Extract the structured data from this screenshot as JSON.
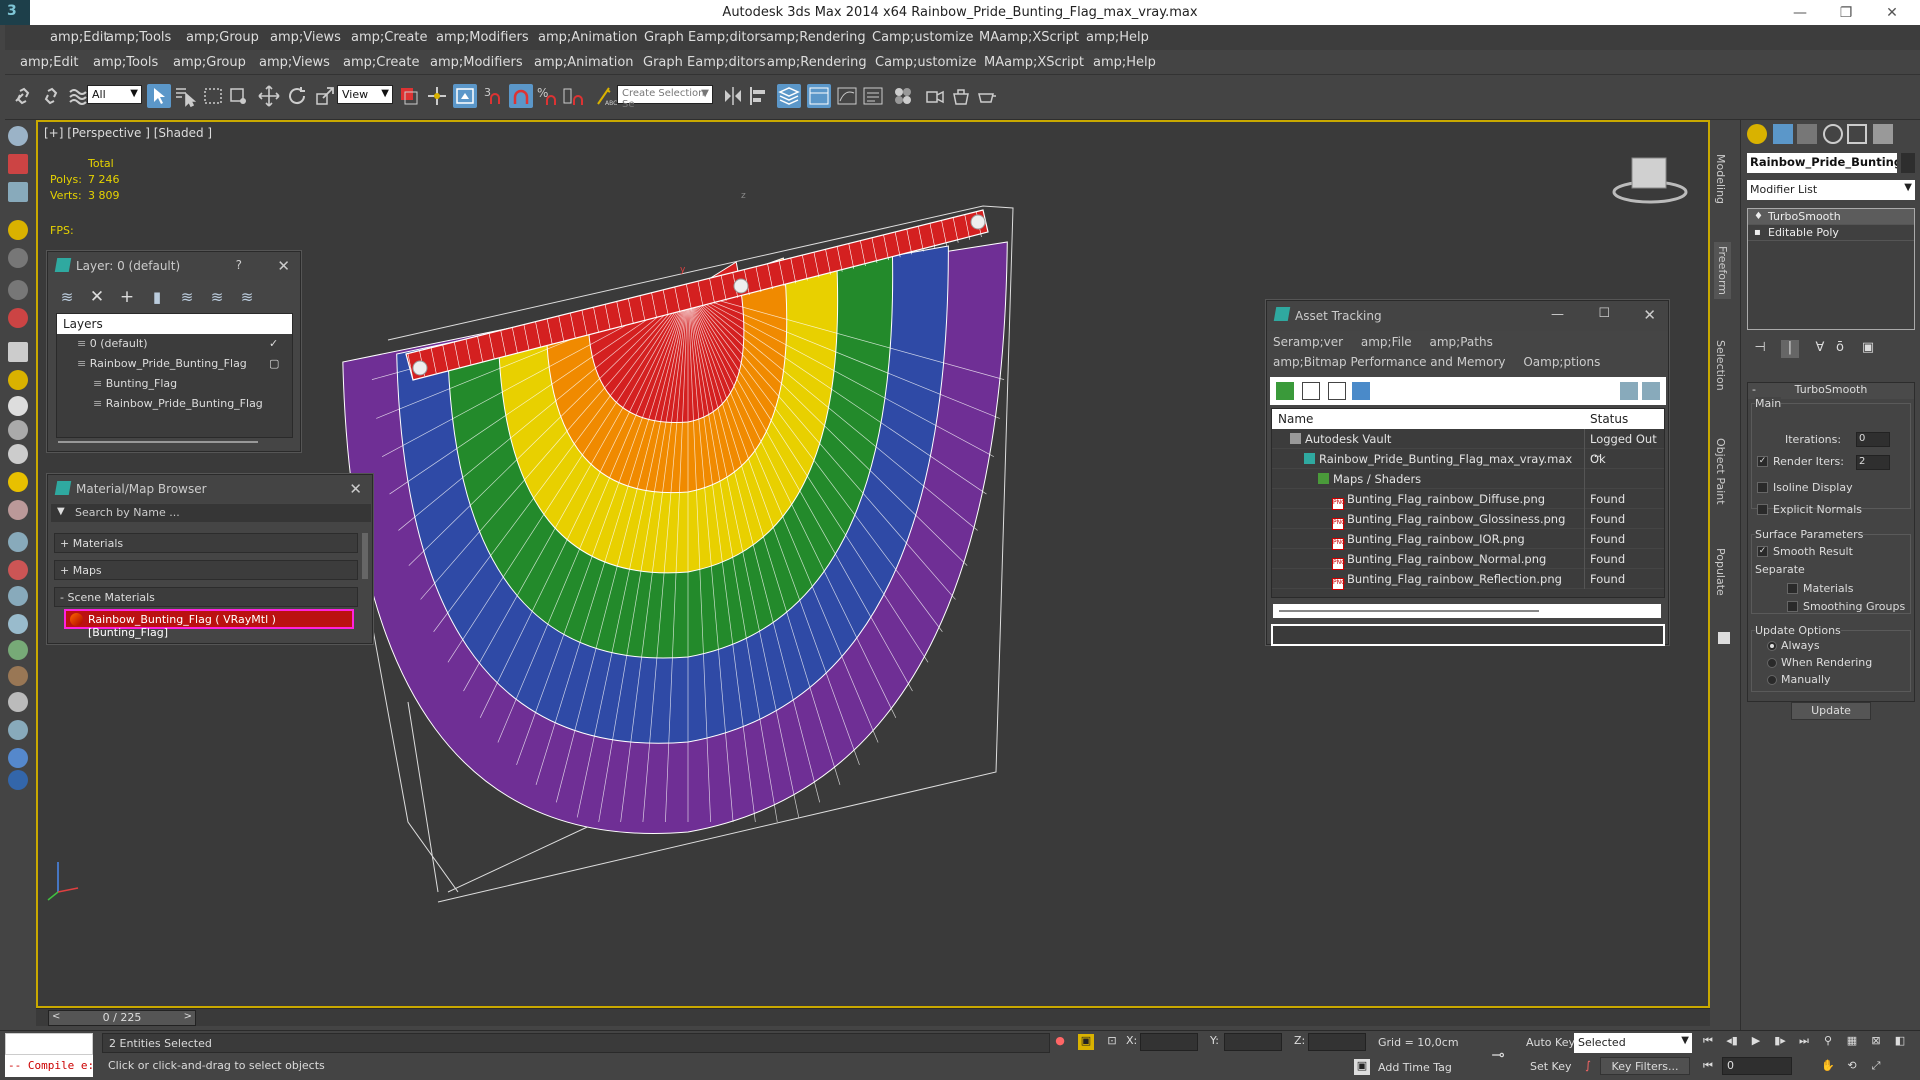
{
  "window": {
    "title": "Autodesk 3ds Max  2014 x64     Rainbow_Pride_Bunting_Flag_max_vray.max",
    "minimize": "—",
    "maximize": "❐",
    "close": "✕"
  },
  "menubar_main": [
    "amp;Edit",
    "amp;Tools",
    "amp;Group",
    "amp;Views",
    "amp;Create",
    "amp;Modifiers",
    "amp;Animation",
    "Graph Eamp;ditors",
    "amp;Rendering",
    "Camp;ustomize",
    "MAamp;XScript",
    "amp;Help"
  ],
  "menubar_secondary": [
    "amp;Edit",
    "amp;Tools",
    "amp;Group",
    "amp;Views",
    "amp;Create",
    "amp;Modifiers",
    "amp;Animation",
    "Graph Eamp;ditors",
    "amp;Rendering",
    "Camp;ustomize",
    "MAamp;XScript",
    "amp;Help"
  ],
  "toolbar": {
    "selection_filter": "All",
    "reference_coord": "View",
    "snap_label": "3",
    "selection_set_placeholder": "Create Selection Se"
  },
  "viewport": {
    "label": "[+] [Perspective ] [Shaded ]",
    "stats": {
      "total_label": "Total",
      "polys_label": "Polys:",
      "polys_value": "7 246",
      "verts_label": "Verts:",
      "verts_value": "3 809",
      "fps_label": "FPS:"
    },
    "axis_z": "z",
    "axis_y": "y"
  },
  "layer_panel": {
    "title": "Layer: 0 (default)",
    "help": "?",
    "close": "✕",
    "header": "Layers",
    "rows": [
      {
        "name": "0 (default)",
        "indent": 0,
        "mark": "✓"
      },
      {
        "name": "Rainbow_Pride_Bunting_Flag",
        "indent": 0,
        "mark": "▢"
      },
      {
        "name": "Bunting_Flag",
        "indent": 1,
        "mark": ""
      },
      {
        "name": "Rainbow_Pride_Bunting_Flag",
        "indent": 1,
        "mark": ""
      }
    ]
  },
  "material_browser": {
    "title": "Material/Map Browser",
    "close": "✕",
    "search_placeholder": "Search by Name ...",
    "groups": [
      "+ Materials",
      "+ Maps",
      "- Scene Materials"
    ],
    "scene_material": "Rainbow_Bunting_Flag  ( VRayMtl )  [Bunting_Flag]"
  },
  "asset_tracking": {
    "title": "Asset Tracking",
    "menu_row1": [
      "Seramp;ver",
      "amp;File",
      "amp;Paths"
    ],
    "menu_row2": [
      "amp;Bitmap Performance and Memory",
      "Oamp;ptions"
    ],
    "columns": [
      "Name",
      "Status"
    ],
    "rows": [
      {
        "name": "Autodesk Vault",
        "status": "Logged Out ...",
        "indent": 1,
        "icon": "vault"
      },
      {
        "name": "Rainbow_Pride_Bunting_Flag_max_vray.max",
        "status": "Ok",
        "indent": 2,
        "icon": "max"
      },
      {
        "name": "Maps / Shaders",
        "status": "",
        "indent": 3,
        "icon": "maps"
      },
      {
        "name": "Bunting_Flag_rainbow_Diffuse.png",
        "status": "Found",
        "indent": 4,
        "icon": "png"
      },
      {
        "name": "Bunting_Flag_rainbow_Glossiness.png",
        "status": "Found",
        "indent": 4,
        "icon": "png"
      },
      {
        "name": "Bunting_Flag_rainbow_IOR.png",
        "status": "Found",
        "indent": 4,
        "icon": "png"
      },
      {
        "name": "Bunting_Flag_rainbow_Normal.png",
        "status": "Found",
        "indent": 4,
        "icon": "png"
      },
      {
        "name": "Bunting_Flag_rainbow_Reflection.png",
        "status": "Found",
        "indent": 4,
        "icon": "png"
      }
    ],
    "png_badge": "PNG"
  },
  "side_tabs": [
    "Modeling",
    "Freeform",
    "Selection",
    "Object Paint",
    "Populate"
  ],
  "command_panel": {
    "object_name": "Rainbow_Pride_Bunting_",
    "modifier_list": "Modifier List",
    "stack": [
      "TurboSmooth",
      "Editable Poly"
    ],
    "rollout_title": "TurboSmooth",
    "main_label": "Main",
    "iterations_label": "Iterations:",
    "iterations_value": "0",
    "render_iters_label": "Render Iters:",
    "render_iters_value": "2",
    "isoline_label": "Isoline Display",
    "explicit_normals_label": "Explicit Normals",
    "surface_params_label": "Surface Parameters",
    "smooth_result_label": "Smooth Result",
    "separate_label": "Separate",
    "materials_label": "Materials",
    "smoothing_groups_label": "Smoothing Groups",
    "update_options_label": "Update Options",
    "always_label": "Always",
    "when_rendering_label": "When Rendering",
    "manually_label": "Manually",
    "update_button": "Update"
  },
  "time_slider": {
    "value": "0 / 225",
    "prev": "<",
    "next": ">"
  },
  "status_bar": {
    "maxscript": "-- Compile e:",
    "selection_info": "2 Entities Selected",
    "prompt": "Click or click-and-drag to select objects",
    "x_label": "X:",
    "y_label": "Y:",
    "z_label": "Z:",
    "grid": "Grid = 10,0cm",
    "add_time_tag": "Add Time Tag",
    "auto_key": "Auto Key",
    "set_key": "Set Key",
    "selected": "Selected",
    "key_filters": "Key Filters...",
    "frame": "0"
  },
  "colors": {
    "viewport_border": "#c9a900",
    "stats_text": "#e6d300",
    "active_tool": "#5b97c9",
    "selected_material": "#bb1111"
  }
}
